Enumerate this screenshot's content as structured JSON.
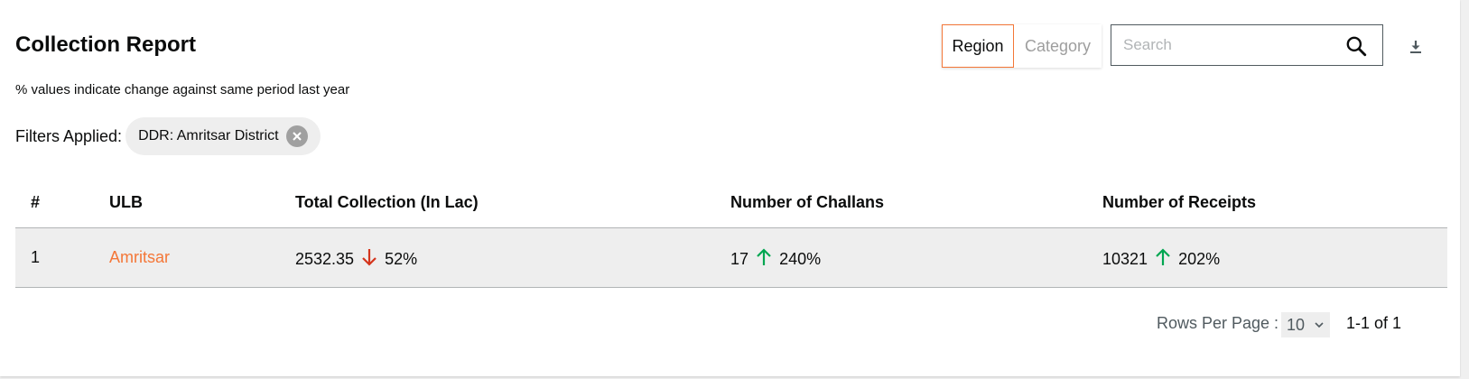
{
  "header": {
    "title": "Collection Report",
    "subtitle": "% values indicate change against same period last year"
  },
  "toggle": {
    "region_label": "Region",
    "category_label": "Category",
    "active": "Region"
  },
  "search": {
    "placeholder": "Search",
    "value": ""
  },
  "icons": {
    "search": "search-icon",
    "download": "download-icon",
    "chip_close": "close-circle-icon",
    "arrow_up": "arrow-up-icon",
    "arrow_down": "arrow-down-icon",
    "dropdown": "chevron-down-icon"
  },
  "filters": {
    "label": "Filters Applied:",
    "chips": [
      "DDR: Amritsar District"
    ]
  },
  "table": {
    "columns": [
      "#",
      "ULB",
      "Total Collection (In Lac)",
      "Number of Challans",
      "Number of Receipts"
    ],
    "rows": [
      {
        "index": "1",
        "ulb": "Amritsar",
        "total_collection": "2532.35",
        "total_change": "52%",
        "total_trend": "down",
        "challans": "17",
        "challans_change": "240%",
        "challans_trend": "up",
        "receipts": "10321",
        "receipts_change": "202%",
        "receipts_trend": "up"
      }
    ]
  },
  "pagination": {
    "rows_per_page_label": "Rows Per Page :",
    "rows_per_page": "10",
    "range": "1-1 of 1"
  },
  "colors": {
    "accent": "#f47738",
    "up": "#00a651",
    "down": "#d4351c",
    "row_bg": "#eeeeee"
  }
}
